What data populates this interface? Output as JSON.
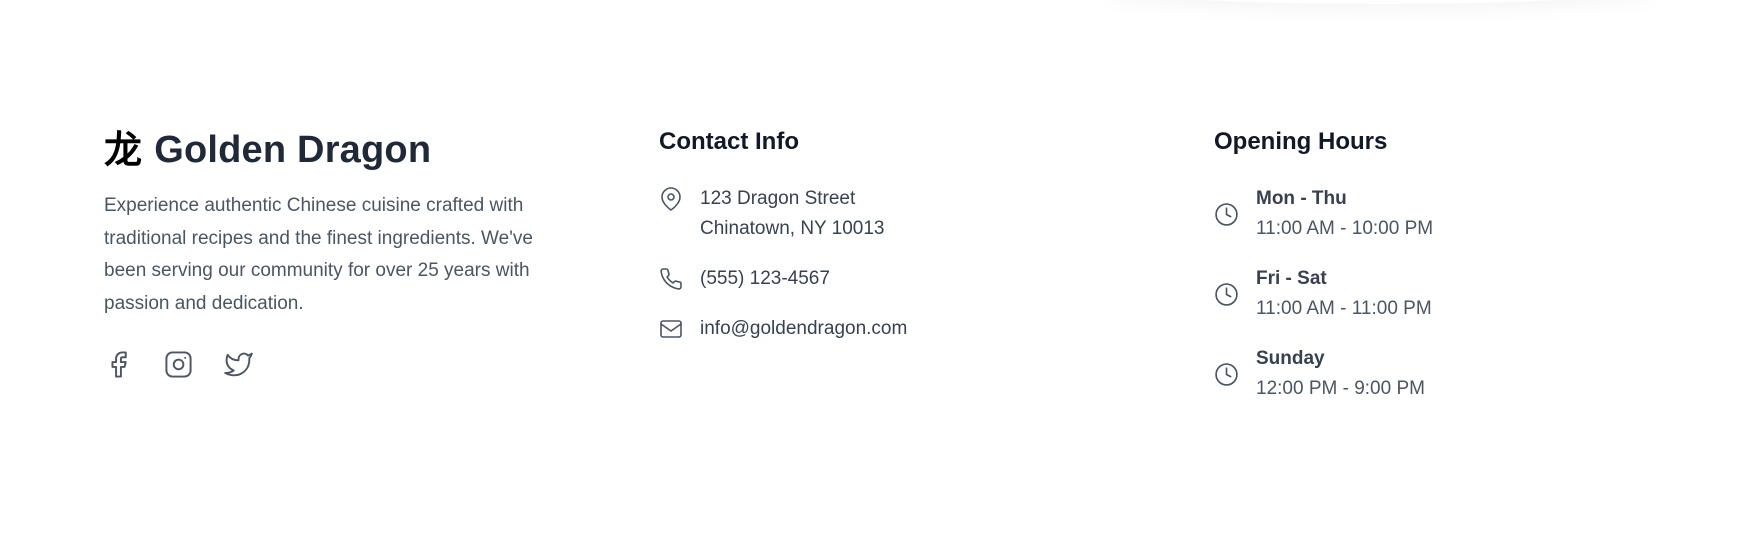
{
  "brand": {
    "glyph": "龙",
    "name": "Golden Dragon",
    "description": "Experience authentic Chinese cuisine crafted with traditional recipes and the finest ingredients. We've been serving our community for over 25 years with passion and dedication."
  },
  "social": [
    {
      "icon": "facebook-icon"
    },
    {
      "icon": "instagram-icon"
    },
    {
      "icon": "twitter-icon"
    }
  ],
  "contact": {
    "title": "Contact Info",
    "address_line1": "123 Dragon Street",
    "address_line2": "Chinatown, NY 10013",
    "phone": "(555) 123-4567",
    "email": "info@goldendragon.com"
  },
  "hours": {
    "title": "Opening Hours",
    "items": [
      {
        "day": "Mon - Thu",
        "time": "11:00 AM - 10:00 PM"
      },
      {
        "day": "Fri - Sat",
        "time": "11:00 AM - 11:00 PM"
      },
      {
        "day": "Sunday",
        "time": "12:00 PM - 9:00 PM"
      }
    ]
  },
  "colors": {
    "heading": "#111827",
    "text": "#374151",
    "muted": "#4b5563",
    "background": "#ffffff"
  }
}
